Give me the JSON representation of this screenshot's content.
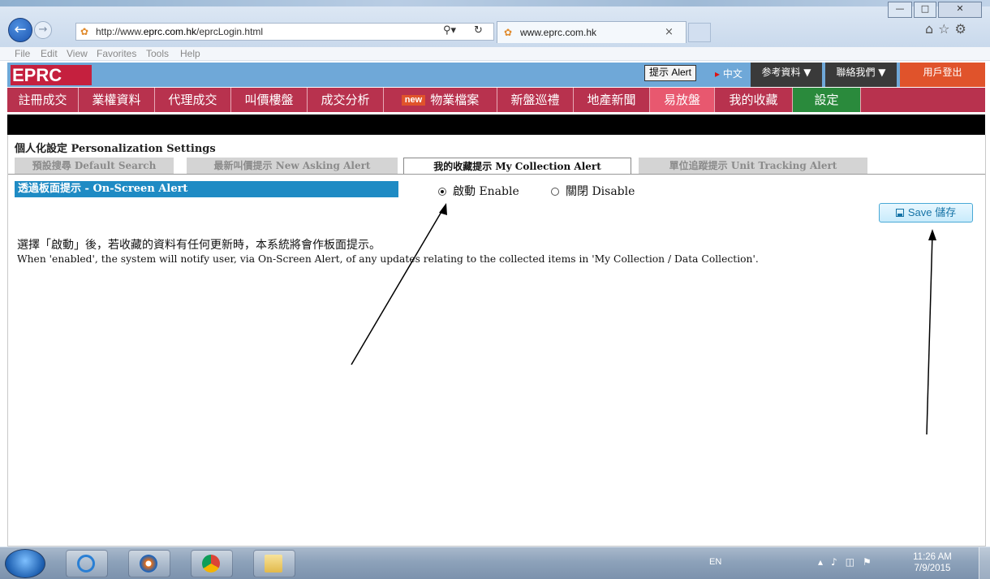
{
  "browser": {
    "url_prefix": "http://www.",
    "url_domain": "eprc.com.hk",
    "url_path": "/eprcLogin.html",
    "tab_title": "www.eprc.com.hk",
    "tab_close": "×",
    "menu": [
      "File",
      "Edit",
      "View",
      "Favorites",
      "Tools",
      "Help"
    ],
    "icons": [
      "back-icon",
      "forward-icon",
      "search-icon",
      "refresh-icon",
      "home-icon",
      "star-icon",
      "gear-icon"
    ]
  },
  "site": {
    "logo": "EPRC",
    "alert_button": "提示 Alert",
    "language": "中文",
    "language_arrow": "▸",
    "top_menus": [
      {
        "label": "参考資料 ▼",
        "color": "#3a3a3a"
      },
      {
        "label": "聯絡我們 ▼",
        "color": "#3a3a3a"
      },
      {
        "label": "用戶登出",
        "color": "#e0532b"
      }
    ],
    "nav": [
      {
        "label": "註冊成交"
      },
      {
        "label": "業權資料"
      },
      {
        "label": "代理成交"
      },
      {
        "label": "叫價樓盤"
      },
      {
        "label": "成交分析"
      },
      {
        "label": "物業檔案",
        "badge": "new"
      },
      {
        "label": "新盤巡禮"
      },
      {
        "label": "地產新聞"
      },
      {
        "label": "易放盤",
        "color": "#e8586f"
      },
      {
        "label": "我的收藏"
      },
      {
        "label": "設定",
        "color": "#2a8a3c"
      }
    ]
  },
  "settings": {
    "title": "個人化設定 Personalization Settings",
    "tabs": [
      {
        "label": "預設搜尋 Default Search",
        "active": false
      },
      {
        "label": "最新叫價提示 New Asking Alert",
        "active": false
      },
      {
        "label": "我的收藏提示 My Collection Alert",
        "active": true
      },
      {
        "label": "單位追蹤提示 Unit Tracking Alert",
        "active": false
      }
    ],
    "alert_row_label": "透過板面提示 - On-Screen Alert",
    "enable_label": "啟動 Enable",
    "disable_label": "關閉 Disable",
    "enabled": true,
    "save_label": "Save 儲存",
    "description_zh": "選擇「啟動」後，若收藏的資料有任何更新時，本系統將會作板面提示。",
    "description_en": "When 'enabled', the system will notify user, via On-Screen Alert, of any updates relating to the collected items in 'My Collection / Data Collection'."
  },
  "taskbar": {
    "language": "EN",
    "time": "11:26 AM",
    "date": "7/9/2015",
    "apps": [
      "windows-start-icon",
      "internet-explorer-icon",
      "media-player-icon",
      "chrome-icon",
      "file-explorer-icon"
    ]
  }
}
